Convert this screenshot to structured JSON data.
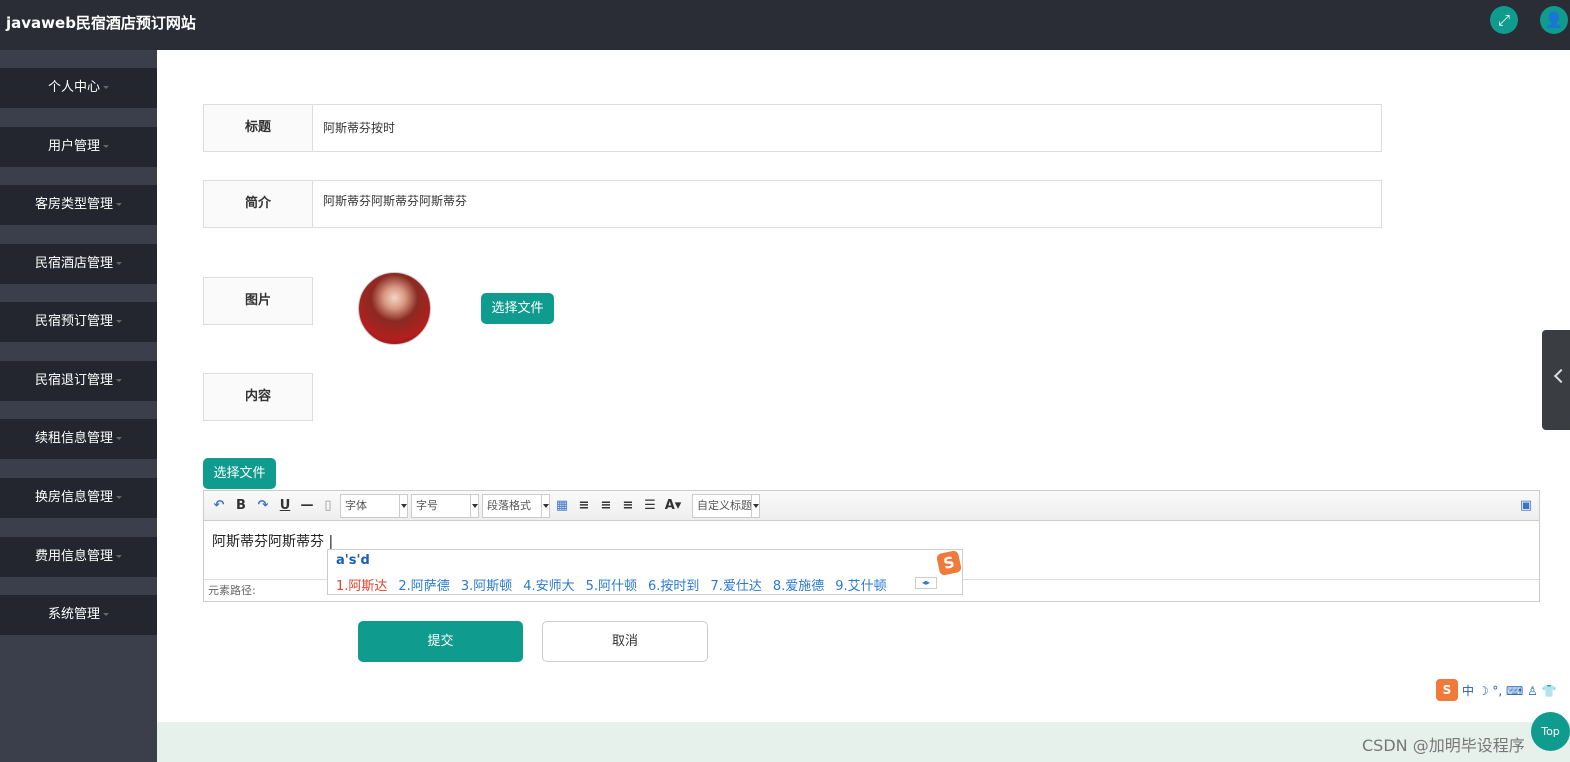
{
  "header": {
    "app_title": "javaweb民宿酒店预订网站",
    "icons": [
      "fullscreen-icon",
      "user-icon"
    ]
  },
  "sidebar": {
    "items": [
      {
        "label": "个人中心"
      },
      {
        "label": "用户管理"
      },
      {
        "label": "客房类型管理"
      },
      {
        "label": "民宿酒店管理"
      },
      {
        "label": "民宿预订管理"
      },
      {
        "label": "民宿退订管理"
      },
      {
        "label": "续租信息管理"
      },
      {
        "label": "换房信息管理"
      },
      {
        "label": "费用信息管理"
      },
      {
        "label": "系统管理"
      }
    ]
  },
  "form": {
    "title_label": "标题",
    "title_value": "阿斯蒂芬按时",
    "intro_label": "简介",
    "intro_value": "阿斯蒂芬阿斯蒂芬阿斯蒂芬",
    "image_label": "图片",
    "choose_file_label": "选择文件",
    "content_label": "内容",
    "content_choose_file_label": "选择文件"
  },
  "editor": {
    "font_select": "字体",
    "size_select": "字号",
    "paragraph_select": "段落格式",
    "custom_title_select": "自定义标题",
    "body_text": "阿斯蒂芬阿斯蒂芬",
    "path_label": "元素路径:"
  },
  "ime": {
    "input": "a's'd",
    "candidates": [
      "1.阿斯达",
      "2.阿萨德",
      "3.阿斯顿",
      "4.安师大",
      "5.阿什顿",
      "6.按时到",
      "7.爱仕达",
      "8.爱施德",
      "9.艾什顿"
    ],
    "status_text": "中 ☽ °, ⌨ ♙ 👕",
    "logo_letter": "S"
  },
  "actions": {
    "submit_label": "提交",
    "cancel_label": "取消"
  },
  "floating": {
    "top_button_label": "Top",
    "watermark": "CSDN @加明毕设程序"
  },
  "colors": {
    "accent": "#0f9b8e",
    "topbar": "#2a2d36",
    "sidebar_item": "#23262f",
    "sidebar_bg": "#3a3f4b",
    "footer": "#e6f1ec"
  }
}
